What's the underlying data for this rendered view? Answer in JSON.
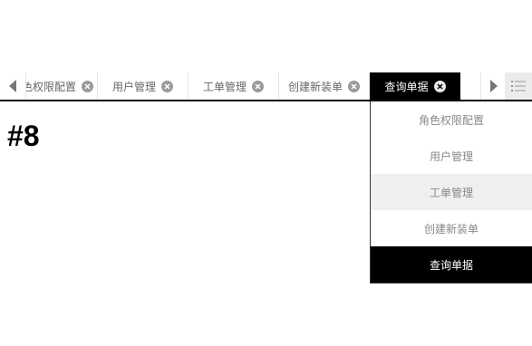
{
  "tabs": [
    {
      "label": "角色权限配置",
      "active": false
    },
    {
      "label": "用户管理",
      "active": false
    },
    {
      "label": "工单管理",
      "active": false
    },
    {
      "label": "创建新装单",
      "active": false
    },
    {
      "label": "查询单据",
      "active": true
    }
  ],
  "content": {
    "title": "#8"
  },
  "dropdown": {
    "items": [
      {
        "label": "角色权限配置",
        "state": "normal"
      },
      {
        "label": "用户管理",
        "state": "normal"
      },
      {
        "label": "工单管理",
        "state": "hover"
      },
      {
        "label": "创建新装单",
        "state": "normal"
      },
      {
        "label": "查询单据",
        "state": "active"
      }
    ]
  },
  "icons": {
    "scroll_left": "triangle-left-icon",
    "scroll_right": "triangle-right-icon",
    "menu": "list-icon",
    "close": "close-circle-icon"
  },
  "colors": {
    "active": "#000000",
    "hover": "#efefef"
  }
}
